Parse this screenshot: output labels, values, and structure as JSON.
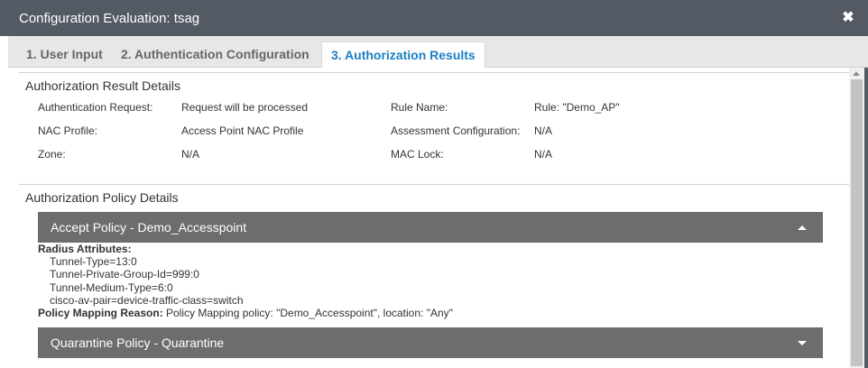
{
  "window": {
    "title": "Configuration Evaluation: tsag",
    "close_glyph": "✖"
  },
  "tabs": [
    {
      "label": "1. User Input"
    },
    {
      "label": "2. Authentication Configuration"
    },
    {
      "label": "3. Authorization Results"
    }
  ],
  "result_details": {
    "title": "Authorization Result Details",
    "fields": {
      "auth_request_label": "Authentication Request:",
      "auth_request_value": "Request will be processed",
      "rule_name_label": "Rule Name:",
      "rule_name_value": "Rule: \"Demo_AP\"",
      "nac_profile_label": "NAC Profile:",
      "nac_profile_value": "Access Point NAC Profile",
      "assessment_label": "Assessment Configuration:",
      "assessment_value": "N/A",
      "zone_label": "Zone:",
      "zone_value": "N/A",
      "mac_lock_label": "MAC Lock:",
      "mac_lock_value": "N/A"
    }
  },
  "policy_details": {
    "title": "Authorization Policy Details",
    "accept_policy": {
      "header": "Accept Policy - Demo_Accesspoint",
      "radius_label": "Radius Attributes:",
      "attributes": [
        "Tunnel-Type=13:0",
        "Tunnel-Private-Group-Id=999:0",
        "Tunnel-Medium-Type=6:0",
        "cisco-av-pair=device-traffic-class=switch"
      ],
      "mapping_label": "Policy Mapping Reason:",
      "mapping_value": "Policy Mapping policy: \"Demo_Accesspoint\", location: \"Any\""
    },
    "quarantine_policy": {
      "header": "Quarantine Policy - Quarantine"
    }
  },
  "colors": {
    "titlebar": "#545a63",
    "active_tab_text": "#1b7fc4",
    "accordion_header": "#6d6d6d"
  }
}
